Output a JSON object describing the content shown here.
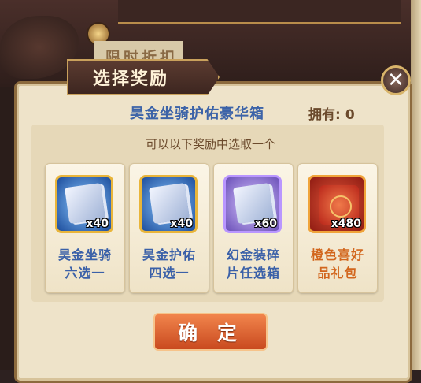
{
  "background": {
    "tab_text": "限时折扣"
  },
  "dialog": {
    "title": "选择奖励",
    "close_icon": "close-icon",
    "box_name": "昊金坐骑护佑豪华箱",
    "owned_label": "拥有:",
    "owned_count": "0",
    "hint": "可以以下奖励中选取一个",
    "confirm_label": "确 定"
  },
  "rewards": [
    {
      "name_line1": "昊金坐骑",
      "name_line2": "六选一",
      "quantity": "x40",
      "icon": "mount-card-icon",
      "rarity_color": "#e9b53a"
    },
    {
      "name_line1": "昊金护佑",
      "name_line2": "四选一",
      "quantity": "x40",
      "icon": "guardian-card-icon",
      "rarity_color": "#e9b53a"
    },
    {
      "name_line1": "幻金装碎",
      "name_line2": "片任选箱",
      "quantity": "x60",
      "icon": "equipment-shard-icon",
      "rarity_color": "#b996ff"
    },
    {
      "name_line1": "橙色喜好",
      "name_line2": "品礼包",
      "quantity": "x480",
      "icon": "gift-pack-icon",
      "rarity_color": "#f0a43a"
    }
  ]
}
